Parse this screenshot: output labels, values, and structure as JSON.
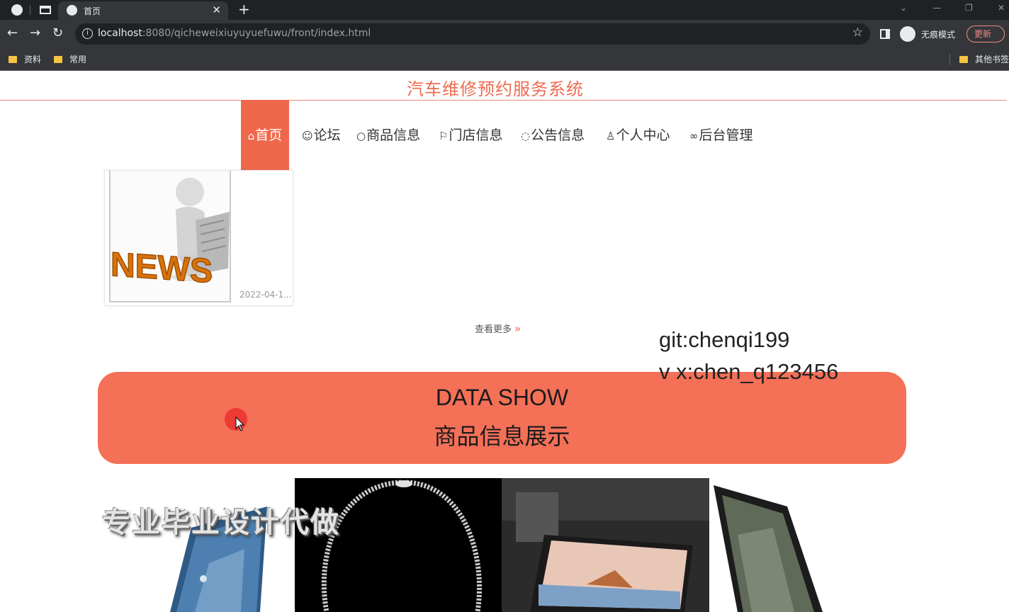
{
  "browser": {
    "tab_title": "首页",
    "url_host": "localhost",
    "url_rest": ":8080/qicheweixiuyuyuefuwu/front/index.html",
    "incognito_label": "无痕模式",
    "update_label": "更新",
    "bookmarks": [
      "资料",
      "常用"
    ],
    "other_bookmarks": "其他书签"
  },
  "site": {
    "title": "汽车维修预约服务系统",
    "nav": [
      {
        "icon": "⌂",
        "label": "首页"
      },
      {
        "icon": "☺",
        "label": "论坛"
      },
      {
        "icon": "○",
        "label": "商品信息"
      },
      {
        "icon": "⚐",
        "label": "门店信息"
      },
      {
        "icon": "◌",
        "label": "公告信息"
      },
      {
        "icon": "♙",
        "label": "个人中心"
      },
      {
        "icon": "∞",
        "label": "后台管理"
      }
    ]
  },
  "news": {
    "image_text": "NEWS",
    "date": "2022-04-1..."
  },
  "more_link": "查看更多",
  "overlay": {
    "line1": "git:chenqi199",
    "line2": "v x:chen_q123456",
    "promo": "专业毕业设计代做"
  },
  "banner": {
    "title_en": "DATA SHOW",
    "title_zh": "商品信息展示"
  },
  "colors": {
    "accent": "#f0684c",
    "banner": "#f47057",
    "chrome_dark": "#202124"
  }
}
